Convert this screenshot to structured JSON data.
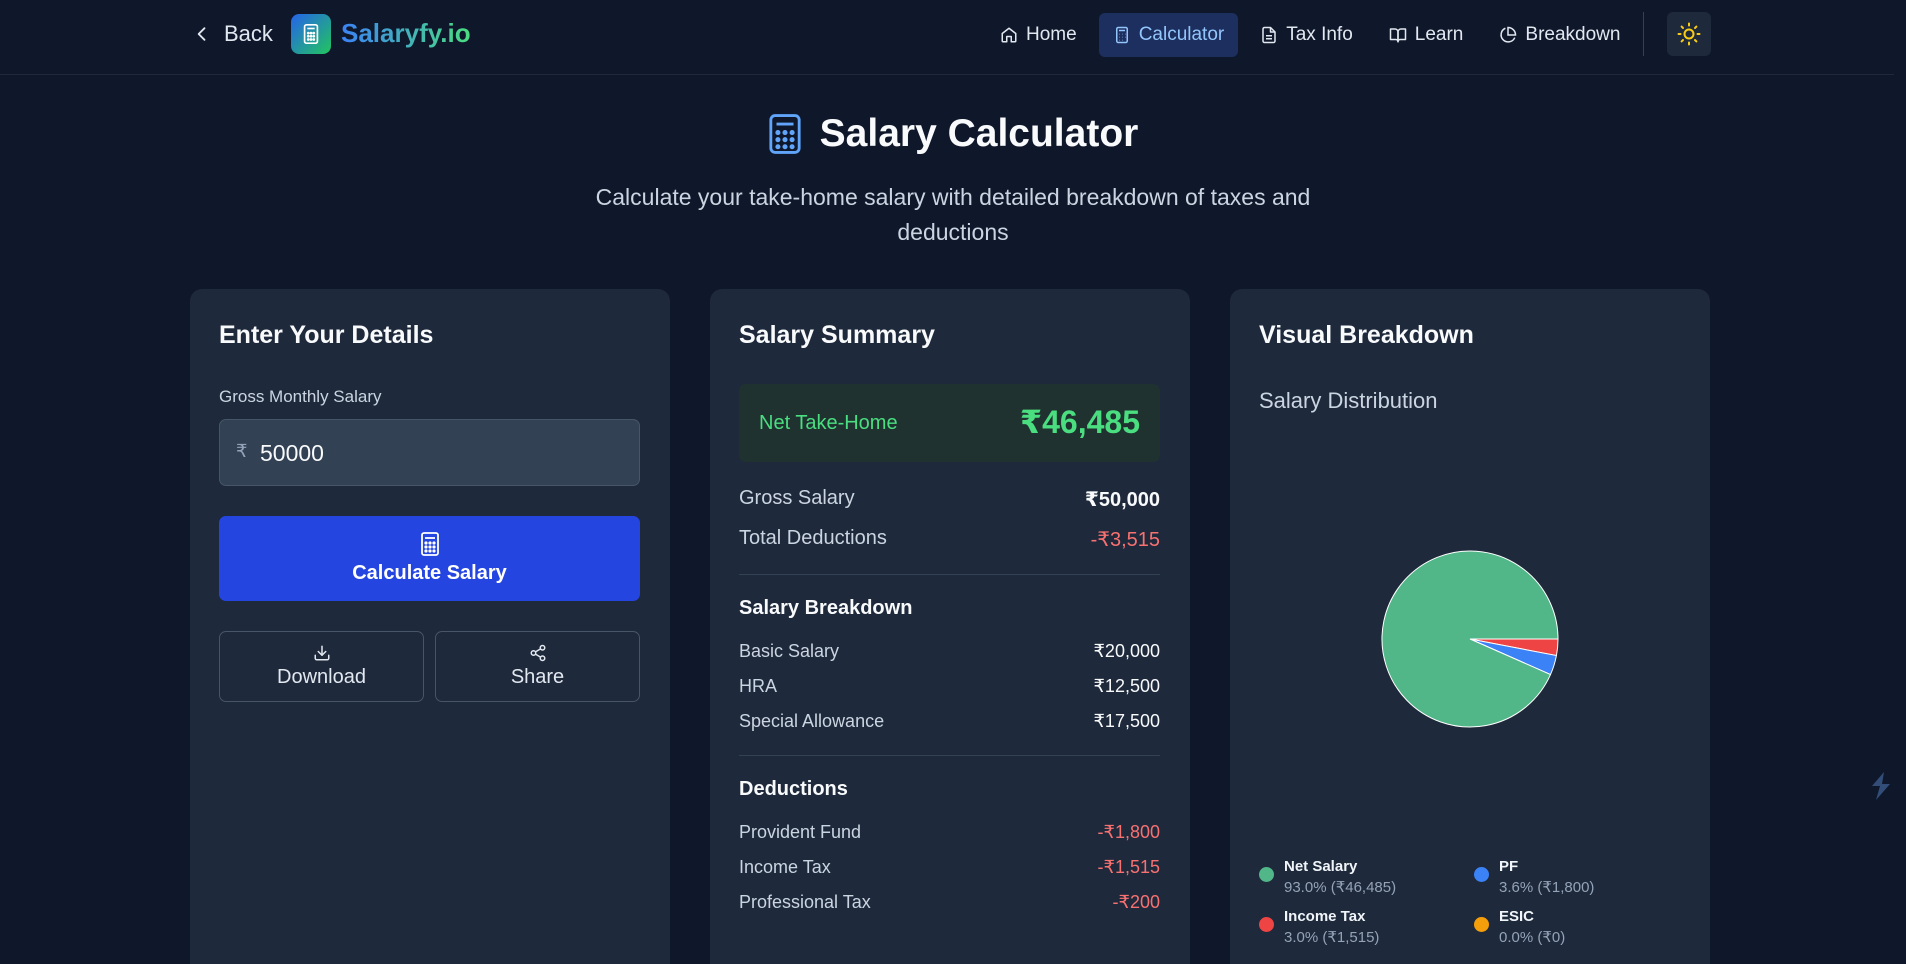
{
  "nav": {
    "back_label": "Back",
    "brand": "Salaryfy.io",
    "items": [
      {
        "label": "Home",
        "icon": "home-icon"
      },
      {
        "label": "Calculator",
        "icon": "calculator-icon",
        "active": true
      },
      {
        "label": "Tax Info",
        "icon": "file-text-icon"
      },
      {
        "label": "Learn",
        "icon": "book-open-icon"
      },
      {
        "label": "Breakdown",
        "icon": "pie-chart-icon"
      }
    ],
    "theme_icon": "sun-icon"
  },
  "hero": {
    "title": "Salary Calculator",
    "subtitle": "Calculate your take-home salary with detailed breakdown of taxes and deductions"
  },
  "details": {
    "title": "Enter Your Details",
    "gross_label": "Gross Monthly Salary",
    "currency_symbol": "₹",
    "gross_value": "50000",
    "calculate_label": "Calculate Salary",
    "download_label": "Download",
    "share_label": "Share"
  },
  "summary": {
    "title": "Salary Summary",
    "net_label": "Net Take-Home",
    "net_value": "₹46,485",
    "gross_label": "Gross Salary",
    "gross_value": "₹50,000",
    "deductions_label": "Total Deductions",
    "deductions_value": "-₹3,515",
    "breakdown_title": "Salary Breakdown",
    "breakdown": [
      {
        "label": "Basic Salary",
        "value": "₹20,000"
      },
      {
        "label": "HRA",
        "value": "₹12,500"
      },
      {
        "label": "Special Allowance",
        "value": "₹17,500"
      }
    ],
    "deductions_title": "Deductions",
    "deductions": [
      {
        "label": "Provident Fund",
        "value": "-₹1,800"
      },
      {
        "label": "Income Tax",
        "value": "-₹1,515"
      },
      {
        "label": "Professional Tax",
        "value": "-₹200"
      }
    ]
  },
  "visual": {
    "title": "Visual Breakdown",
    "chart_title": "Salary Distribution"
  },
  "chart_data": {
    "type": "pie",
    "title": "Salary Distribution",
    "slices": [
      {
        "name": "Net Salary",
        "percent": 93.0,
        "amount": "₹46,485",
        "pct_label": "93.0% (₹46,485)",
        "color": "#52b788"
      },
      {
        "name": "PF",
        "percent": 3.6,
        "amount": "₹1,800",
        "pct_label": "3.6% (₹1,800)",
        "color": "#3b82f6"
      },
      {
        "name": "Income Tax",
        "percent": 3.0,
        "amount": "₹1,515",
        "pct_label": "3.0% (₹1,515)",
        "color": "#ef4444"
      },
      {
        "name": "ESIC",
        "percent": 0.0,
        "amount": "₹0",
        "pct_label": "0.0% (₹0)",
        "color": "#f59e0b"
      }
    ],
    "legend_position": "bottom"
  }
}
